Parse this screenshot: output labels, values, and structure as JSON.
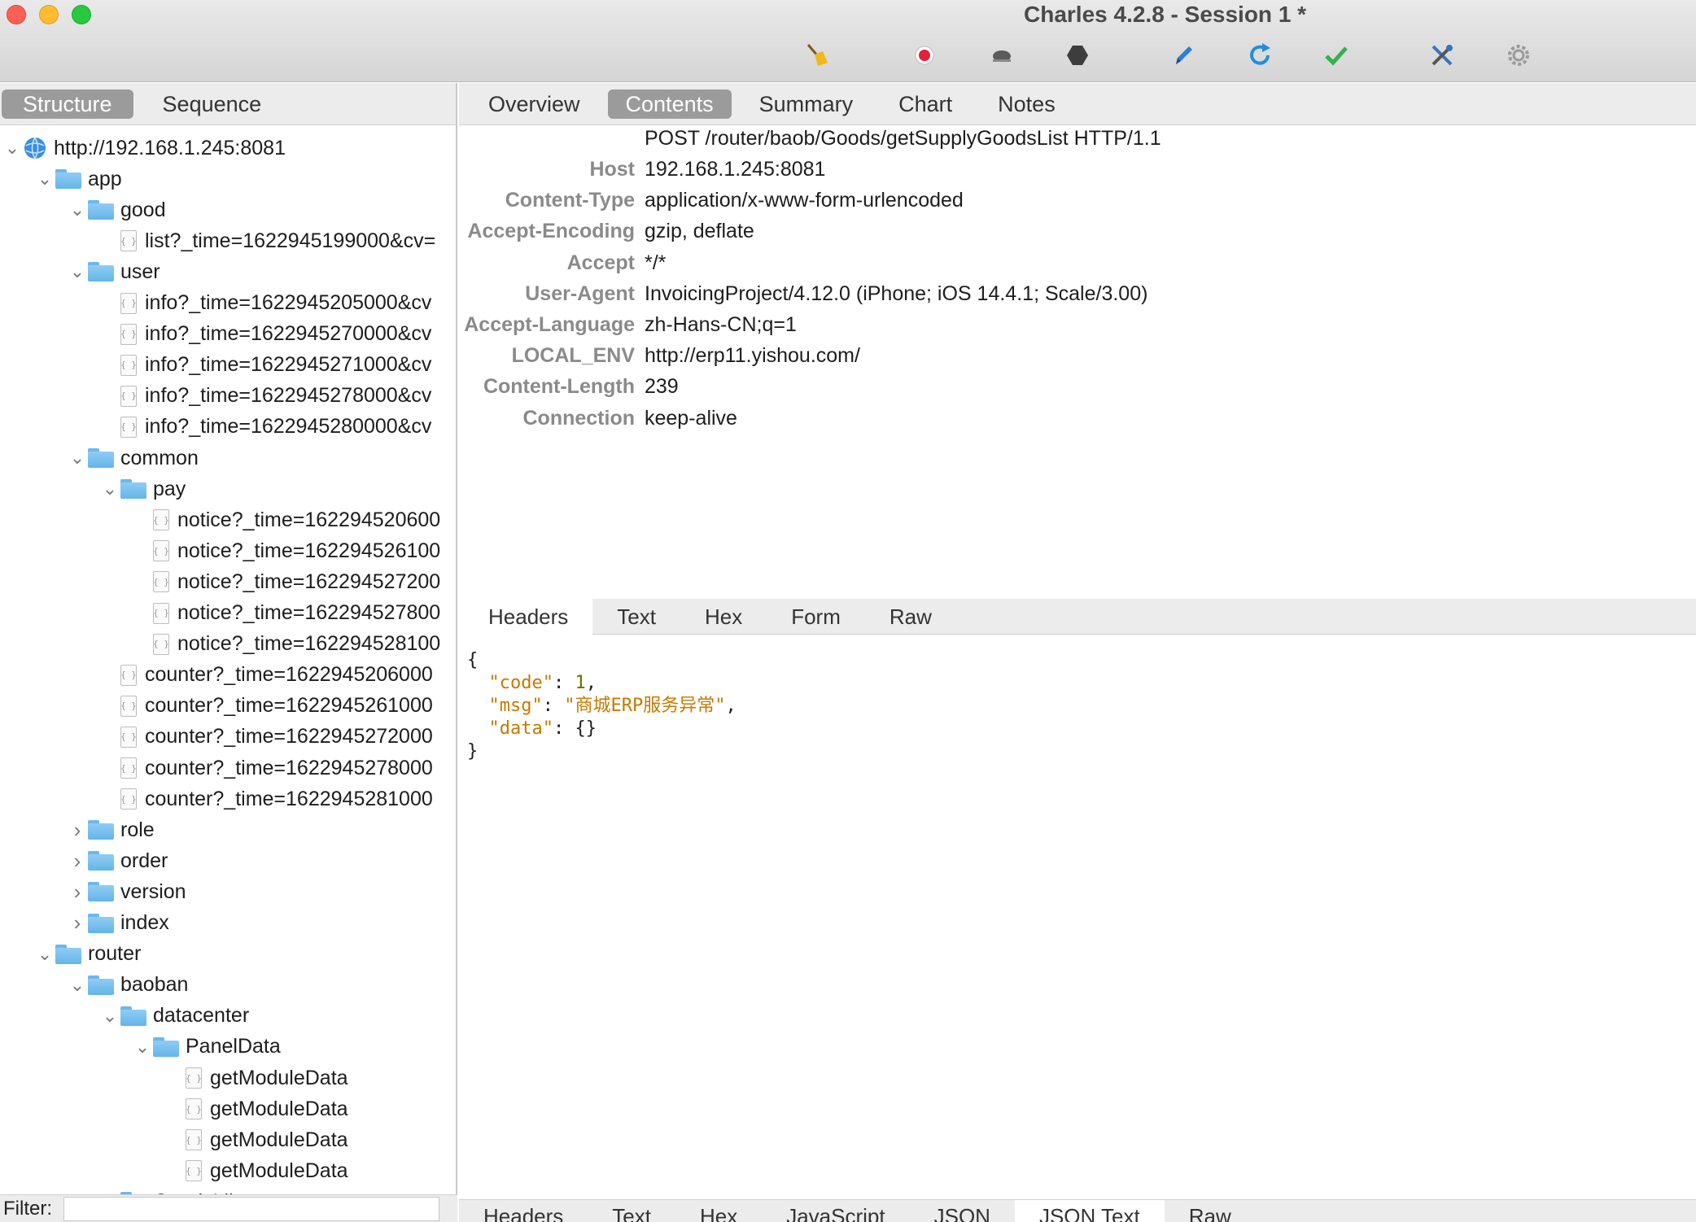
{
  "window": {
    "title": "Charles 4.2.8 - Session 1 *"
  },
  "toolbar": {
    "icons": [
      "broom-icon",
      "record-icon",
      "throttle-turtle-icon",
      "breakpoint-hexagon-icon",
      "compose-pen-icon",
      "repeat-refresh-icon",
      "validate-check-icon",
      "tools-icon",
      "settings-gear-icon"
    ],
    "colors": {
      "record": "#e0223b",
      "refresh": "#1f8fe0",
      "check": "#34b24a",
      "pen": "#2a7fd8"
    }
  },
  "left_panel": {
    "tabs": [
      "Structure",
      "Sequence"
    ],
    "active_tab": "Structure",
    "tree": [
      {
        "label": "http://192.168.1.245:8081",
        "type": "host",
        "expanded": true
      },
      {
        "label": "app",
        "type": "folder",
        "expanded": true
      },
      {
        "label": "good",
        "type": "folder",
        "expanded": true
      },
      {
        "label": "list?_time=1622945199000&cv=",
        "type": "file"
      },
      {
        "label": "user",
        "type": "folder",
        "expanded": true
      },
      {
        "label": "info?_time=1622945205000&cv",
        "type": "file"
      },
      {
        "label": "info?_time=1622945270000&cv",
        "type": "file"
      },
      {
        "label": "info?_time=1622945271000&cv",
        "type": "file"
      },
      {
        "label": "info?_time=1622945278000&cv",
        "type": "file"
      },
      {
        "label": "info?_time=1622945280000&cv",
        "type": "file"
      },
      {
        "label": "common",
        "type": "folder",
        "expanded": true
      },
      {
        "label": "pay",
        "type": "folder",
        "expanded": true
      },
      {
        "label": "notice?_time=162294520600",
        "type": "file"
      },
      {
        "label": "notice?_time=162294526100",
        "type": "file"
      },
      {
        "label": "notice?_time=162294527200",
        "type": "file"
      },
      {
        "label": "notice?_time=162294527800",
        "type": "file"
      },
      {
        "label": "notice?_time=162294528100",
        "type": "file"
      },
      {
        "label": "counter?_time=1622945206000",
        "type": "file"
      },
      {
        "label": "counter?_time=1622945261000",
        "type": "file"
      },
      {
        "label": "counter?_time=1622945272000",
        "type": "file"
      },
      {
        "label": "counter?_time=1622945278000",
        "type": "file"
      },
      {
        "label": "counter?_time=1622945281000",
        "type": "file"
      },
      {
        "label": "role",
        "type": "folder",
        "expanded": false
      },
      {
        "label": "order",
        "type": "folder",
        "expanded": false
      },
      {
        "label": "version",
        "type": "folder",
        "expanded": false
      },
      {
        "label": "index",
        "type": "folder",
        "expanded": false
      },
      {
        "label": "router",
        "type": "folder",
        "expanded": true
      },
      {
        "label": "baoban",
        "type": "folder",
        "expanded": true
      },
      {
        "label": "datacenter",
        "type": "folder",
        "expanded": true
      },
      {
        "label": "PanelData",
        "type": "folder",
        "expanded": true
      },
      {
        "label": "getModuleData",
        "type": "file"
      },
      {
        "label": "getModuleData",
        "type": "file"
      },
      {
        "label": "getModuleData",
        "type": "file"
      },
      {
        "label": "getModuleData",
        "type": "file"
      },
      {
        "label": "GoodsLib",
        "type": "folder",
        "expanded": true
      }
    ],
    "filter": {
      "label": "Filter:",
      "value": ""
    }
  },
  "right_panel": {
    "tabs": [
      "Overview",
      "Contents",
      "Summary",
      "Chart",
      "Notes"
    ],
    "active_tab": "Contents",
    "request_line": "POST /router/baob/Goods/getSupplyGoodsList HTTP/1.1",
    "headers": [
      {
        "key": "Host",
        "value": "192.168.1.245:8081"
      },
      {
        "key": "Content-Type",
        "value": "application/x-www-form-urlencoded"
      },
      {
        "key": "Accept-Encoding",
        "value": "gzip, deflate"
      },
      {
        "key": "Accept",
        "value": "*/*"
      },
      {
        "key": "User-Agent",
        "value": "InvoicingProject/4.12.0 (iPhone; iOS 14.4.1; Scale/3.00)"
      },
      {
        "key": "Accept-Language",
        "value": "zh-Hans-CN;q=1"
      },
      {
        "key": "LOCAL_ENV",
        "value": "http://erp11.yishou.com/"
      },
      {
        "key": "Content-Length",
        "value": "239"
      },
      {
        "key": "Connection",
        "value": "keep-alive"
      }
    ],
    "request_subtabs": [
      "Headers",
      "Text",
      "Hex",
      "Form",
      "Raw"
    ],
    "request_active_subtab": "Headers",
    "response_json": {
      "open": "{",
      "close": "}",
      "lines": [
        {
          "key": "\"code\"",
          "sep": ": ",
          "value": "1",
          "kind": "num",
          "trail": ","
        },
        {
          "key": "\"msg\"",
          "sep": ": ",
          "value": "\"商城ERP服务异常\"",
          "kind": "str",
          "trail": ","
        },
        {
          "key": "\"data\"",
          "sep": ": ",
          "value": "{}",
          "kind": "plain",
          "trail": ""
        }
      ]
    },
    "response_subtabs": [
      "Headers",
      "Text",
      "Hex",
      "JavaScript",
      "JSON",
      "JSON Text",
      "Raw"
    ],
    "response_active_subtab": "JSON Text"
  }
}
